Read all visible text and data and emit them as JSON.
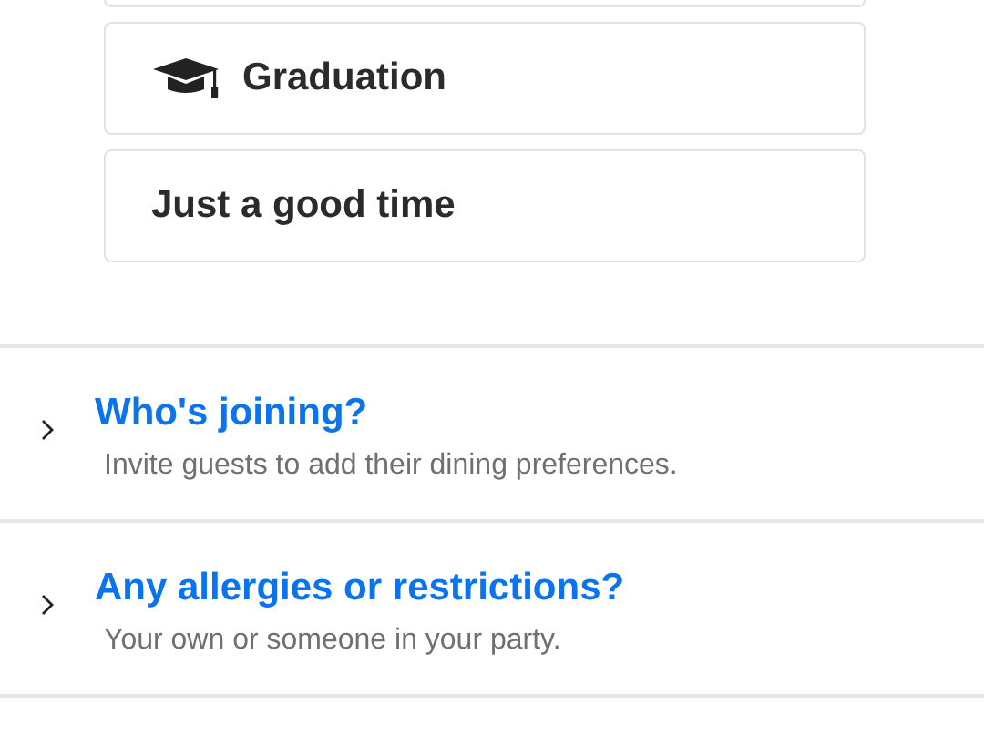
{
  "options": [
    {
      "kind": "with-icon",
      "label": "Graduation"
    },
    {
      "kind": "plain",
      "label": "Just a good time"
    }
  ],
  "sections": [
    {
      "title": "Who's joining?",
      "subtitle": "Invite guests to add their dining preferences.",
      "expanded": false
    },
    {
      "title": "Any allergies or restrictions?",
      "subtitle": "Your own or someone in your party.",
      "expanded": false
    }
  ]
}
